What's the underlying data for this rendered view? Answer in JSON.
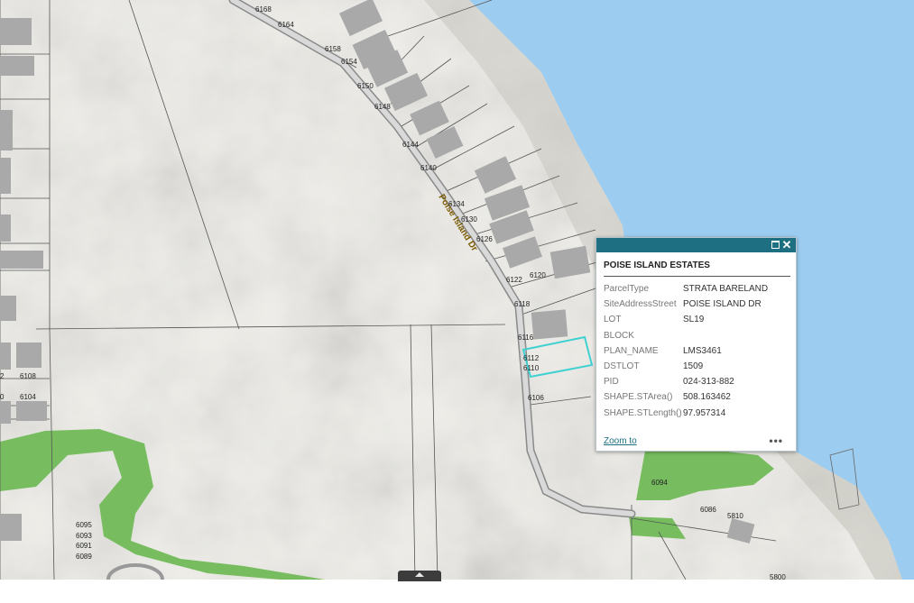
{
  "map": {
    "colors": {
      "water": "#9ccdf0",
      "land": "#efeee9",
      "park": "#77bd5f",
      "building": "#a9a9a9",
      "selected_parcel": "#3fd1d1"
    },
    "road_name": "Poise Island Dr",
    "house_numbers": [
      "6168",
      "6164",
      "6158",
      "6154",
      "6150",
      "6148",
      "6144",
      "6140",
      "6134",
      "6130",
      "6126",
      "6122",
      "6120",
      "6118",
      "6116",
      "6112",
      "6110",
      "6106",
      "6108",
      "6104",
      "6095",
      "6093",
      "6091",
      "6089",
      "6094",
      "6086",
      "5810",
      "5800",
      "2",
      "0"
    ]
  },
  "popup": {
    "title": "POISE ISLAND ESTATES",
    "fields": [
      {
        "key": "ParcelType",
        "value": "STRATA BARELAND"
      },
      {
        "key": "SiteAddressStreet",
        "value": "POISE ISLAND DR"
      },
      {
        "key": "LOT",
        "value": "SL19"
      },
      {
        "key": "BLOCK",
        "value": ""
      },
      {
        "key": "PLAN_NAME",
        "value": "LMS3461"
      },
      {
        "key": "DSTLOT",
        "value": "1509"
      },
      {
        "key": "PID",
        "value": "024-313-882"
      },
      {
        "key": "SHAPE.STArea()",
        "value": "508.163462"
      },
      {
        "key": "SHAPE.STLength()",
        "value": "97.957314"
      }
    ],
    "zoom_label": "Zoom to",
    "more_label": "•••",
    "close_label": "✕",
    "header_color": "#1f6f82"
  }
}
